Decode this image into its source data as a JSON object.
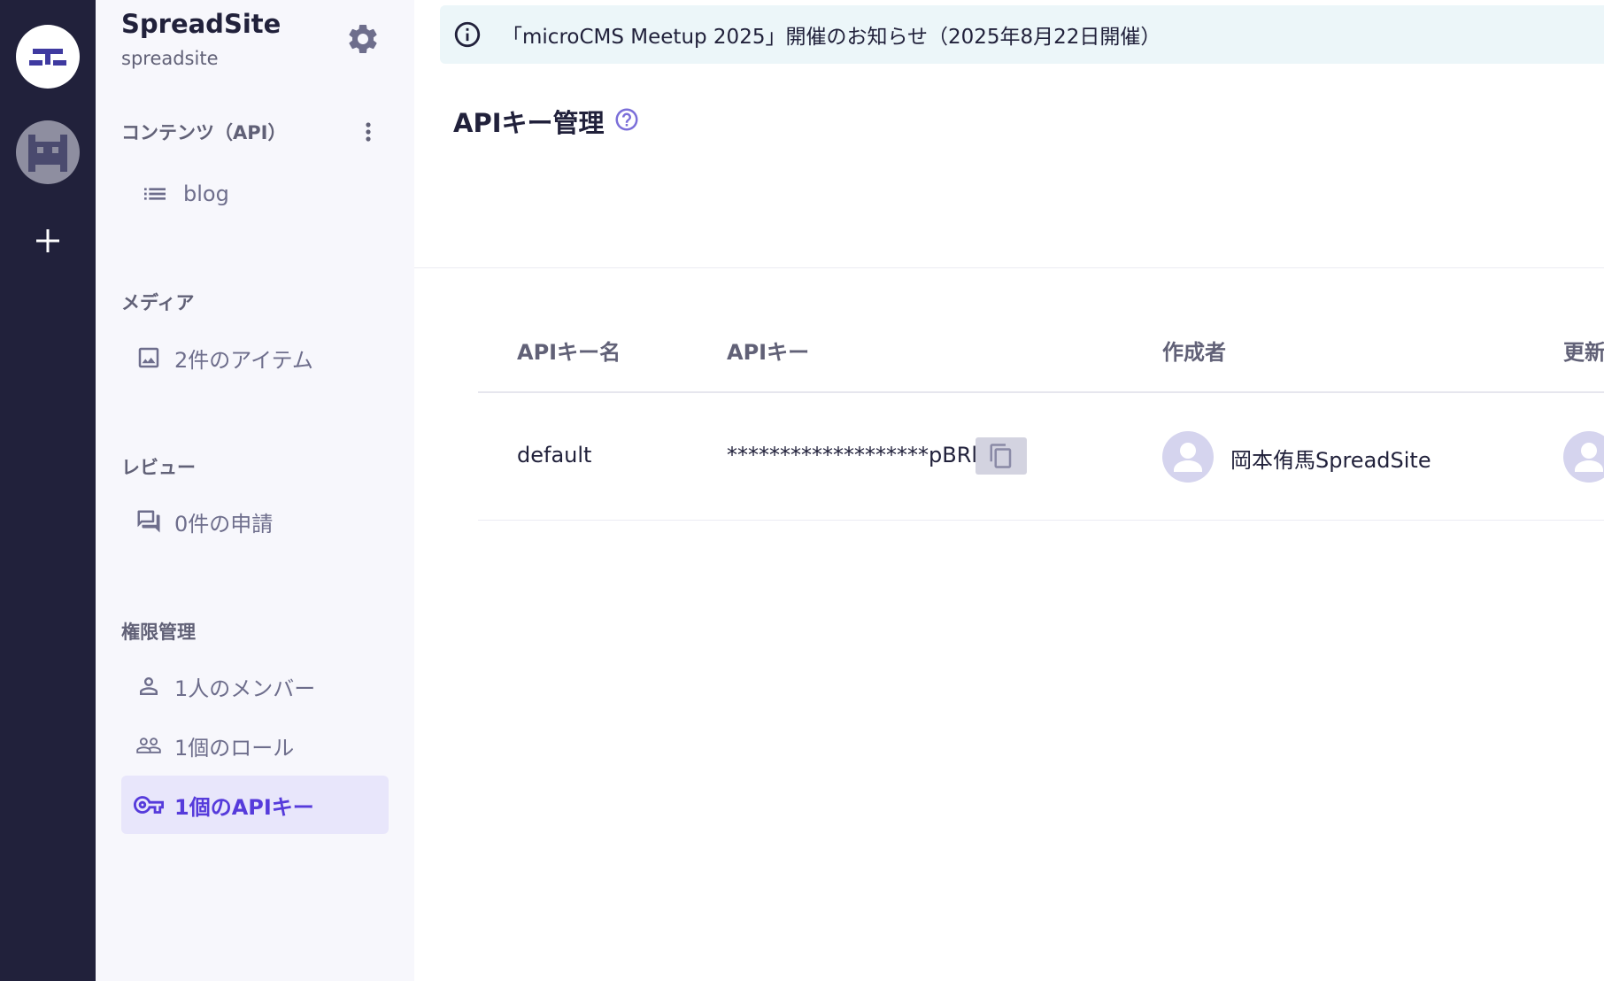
{
  "colors": {
    "rail_bg": "#21213b",
    "sidebar_bg": "#f7f7fc",
    "accent": "#563bdb",
    "active_item_bg": "#e8e6fb",
    "notice_bg": "#ecf6f9",
    "muted_text": "#6e6e8c"
  },
  "rail": {
    "services": [
      {
        "icon": "spreadsite-logo-icon",
        "active": true
      },
      {
        "icon": "pixel-monster-avatar-icon",
        "active": false
      }
    ],
    "add_icon": "plus-icon"
  },
  "sidebar": {
    "service_name": "SpreadSite",
    "service_id": "spreadsite",
    "settings_icon": "gear-icon",
    "sections": {
      "content": {
        "title": "コンテンツ（API）",
        "items": [
          {
            "label": "blog",
            "icon": "list-icon"
          }
        ]
      },
      "media": {
        "title": "メディア",
        "items": [
          {
            "label": "2件のアイテム",
            "icon": "image-icon"
          }
        ]
      },
      "review": {
        "title": "レビュー",
        "items": [
          {
            "label": "0件の申請",
            "icon": "chat-icon"
          }
        ]
      },
      "permissions": {
        "title": "権限管理",
        "items": [
          {
            "label": "1人のメンバー",
            "icon": "person-icon"
          },
          {
            "label": "1個のロール",
            "icon": "people-icon"
          },
          {
            "label": "1個のAPIキー",
            "icon": "key-icon",
            "active": true
          }
        ]
      }
    }
  },
  "main": {
    "notice": "「microCMS Meetup 2025」開催のお知らせ（2025年8月22日開催）",
    "page_title": "APIキー管理",
    "table": {
      "headers": [
        "APIキー名",
        "APIキー",
        "作成者",
        "更新"
      ],
      "rows": [
        {
          "name": "default",
          "api_key": "*******************pBRl",
          "creator": "岡本侑馬SpreadSite"
        }
      ]
    }
  }
}
